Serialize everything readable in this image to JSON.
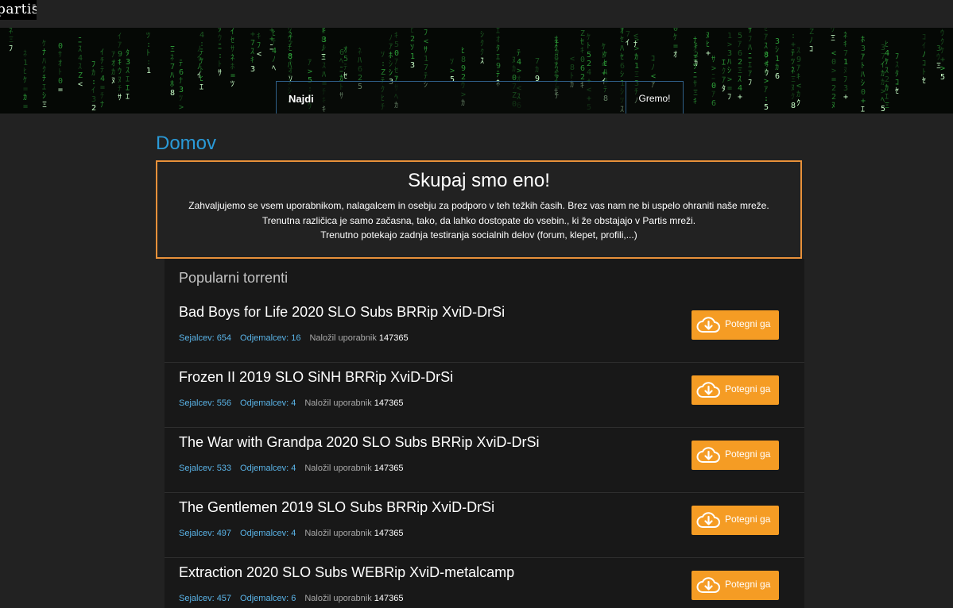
{
  "header": {
    "logo_text": "partis",
    "logo_mark": "®"
  },
  "search": {
    "placeholder": "Najdi",
    "button_label": "Gremo!"
  },
  "page": {
    "title": "Domov"
  },
  "notice": {
    "heading": "Skupaj smo eno!",
    "lines": [
      "Zahvaljujemo se vsem uporabnikom, nalagalcem in osebju za podporo v teh težkih časih. Brez vas nam ne bi uspelo ohraniti naše mreže.",
      "Trenutna različica je samo začasna, tako, da lahko dostopate do vsebin., ki že obstajajo v Partis mreži.",
      "Trenutno potekajo zadnja testiranja socialnih delov (forum, klepet, profili,...)"
    ]
  },
  "popular": {
    "title": "Popularni torrenti",
    "download_label": "Potegni ga",
    "uploader_label": "Naložil uporabnik",
    "items": [
      {
        "title": "Bad Boys for Life 2020 SLO Subs BRRip XviD-DrSi",
        "seeders": "Sejalcev: 654",
        "leechers": "Odjemalcev: 16",
        "uploader": "147365"
      },
      {
        "title": "Frozen II 2019 SLO SiNH BRRip XviD-DrSi",
        "seeders": "Sejalcev: 556",
        "leechers": "Odjemalcev: 4",
        "uploader": "147365"
      },
      {
        "title": "The War with Grandpa 2020 SLO Subs BRRip XviD-DrSi",
        "seeders": "Sejalcev: 533",
        "leechers": "Odjemalcev: 4",
        "uploader": "147365"
      },
      {
        "title": "The Gentlemen 2019 SLO Subs BRRip XviD-DrSi",
        "seeders": "Sejalcev: 497",
        "leechers": "Odjemalcev: 4",
        "uploader": "147365"
      },
      {
        "title": "Extraction 2020 SLO Subs WEBRip XviD-metalcamp",
        "seeders": "Sejalcev: 457",
        "leechers": "Odjemalcev: 6",
        "uploader": "147365"
      }
    ]
  },
  "colors": {
    "accent_blue": "#2a9ad8",
    "download_orange": "#f59c24",
    "notice_border": "#e8913a",
    "matrix_green": "#3bd14a"
  }
}
